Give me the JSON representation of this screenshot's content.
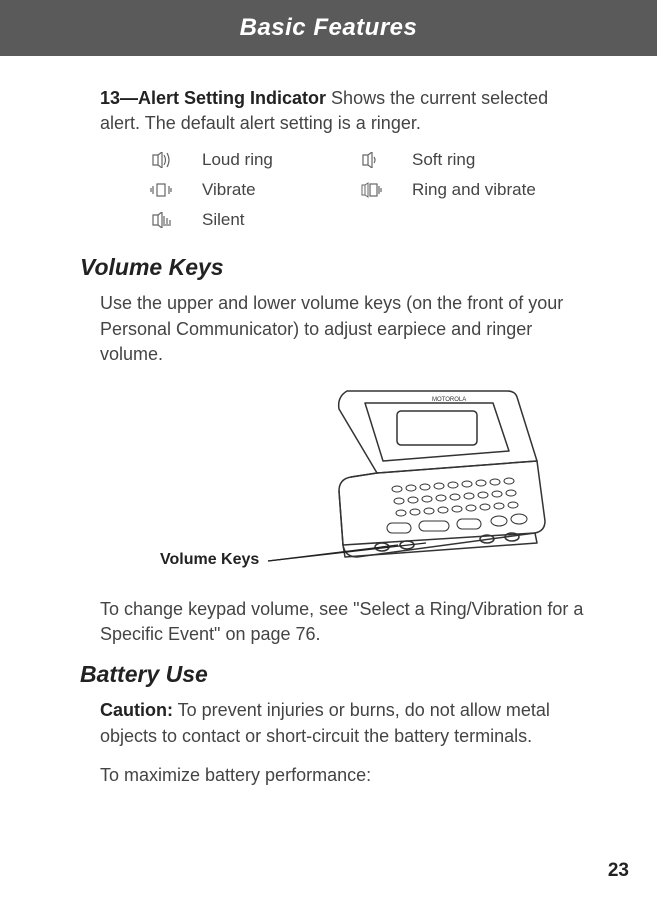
{
  "header": {
    "title": "Basic Features"
  },
  "sec13": {
    "lead_bold": "13—Alert Setting Indicator",
    "lead_rest": "  Shows the current selected alert. The default alert setting is a ringer."
  },
  "alerts": {
    "r1c1": "Loud ring",
    "r1c2": "Soft ring",
    "r2c1": "Vibrate",
    "r2c2": "Ring and vibrate",
    "r3c1": "Silent"
  },
  "icons": {
    "loud": "loud-ring-icon",
    "soft": "soft-ring-icon",
    "vibrate": "vibrate-icon",
    "ring_vibrate": "ring-and-vibrate-icon",
    "silent": "silent-icon"
  },
  "volume_keys": {
    "heading": "Volume Keys",
    "para": "Use the upper and lower volume keys (on the front of your Personal Communicator) to adjust earpiece and ringer volume.",
    "callout": "Volume Keys",
    "after": "To change keypad volume, see \"Select a Ring/Vibration for a Specific Event\" on page 76."
  },
  "battery": {
    "heading": "Battery Use",
    "caution_label": "Caution:",
    "caution_rest": " To prevent injuries or burns, do not allow metal objects to contact or short-circuit the battery terminals.",
    "maximize": "To maximize battery performance:"
  },
  "page_number": "23"
}
